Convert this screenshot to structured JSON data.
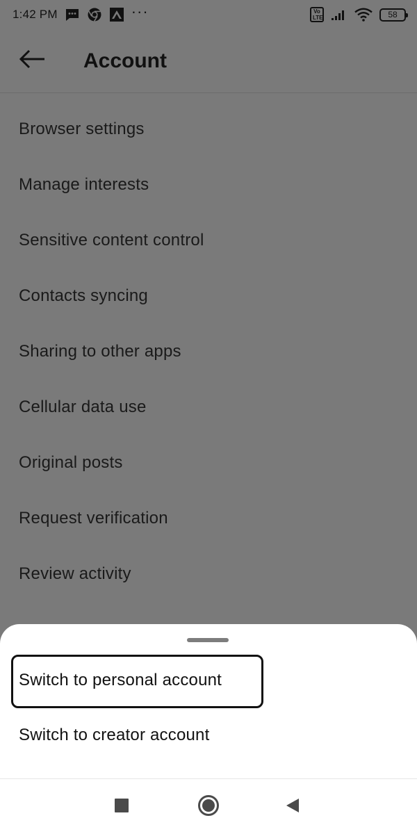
{
  "status_bar": {
    "time": "1:42 PM",
    "more": "···",
    "volte": "Vo LTE",
    "battery": "58",
    "icons": [
      "message-icon",
      "chrome-icon",
      "app-icon",
      "volte-icon",
      "signal-icon",
      "wifi-icon",
      "battery-icon"
    ]
  },
  "header": {
    "title": "Account",
    "back_icon": "arrow-left-icon"
  },
  "settings": {
    "items": [
      "Browser settings",
      "Manage interests",
      "Sensitive content control",
      "Contacts syncing",
      "Sharing to other apps",
      "Cellular data use",
      "Original posts",
      "Request verification",
      "Review activity"
    ]
  },
  "sheet": {
    "options": [
      "Switch to personal account",
      "Switch to creator account"
    ],
    "highlighted_index": 0
  },
  "nav": {
    "icons": [
      "recents-square-icon",
      "home-circle-icon",
      "back-triangle-icon"
    ]
  },
  "colors": {
    "scrim": "#7a7a7a",
    "sheet": "#ffffff",
    "text": "#111111",
    "handle": "#7d7d7d"
  }
}
